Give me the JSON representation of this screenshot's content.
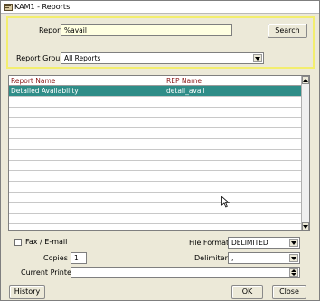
{
  "window": {
    "title": "KAM1 - Reports"
  },
  "search": {
    "report_label": "Report",
    "report_value": "%avail",
    "search_button": "Search",
    "group_label": "Report Group",
    "group_value": "All Reports"
  },
  "grid": {
    "columns": [
      "Report Name",
      "REP Name"
    ],
    "rows": [
      {
        "name": "Detailed Availability",
        "rep": "detail_avail",
        "selected": true
      }
    ]
  },
  "options": {
    "fax_label": "Fax / E-mail",
    "fax_checked": false,
    "copies_label": "Copies",
    "copies_value": "1",
    "format_label": "File Format",
    "format_value": "DELIMITED",
    "delimiter_label": "Delimiter",
    "delimiter_value": ",",
    "printer_label": "Current Printer",
    "printer_value": ""
  },
  "buttons": {
    "history": "History",
    "ok": "OK",
    "close": "Close"
  }
}
